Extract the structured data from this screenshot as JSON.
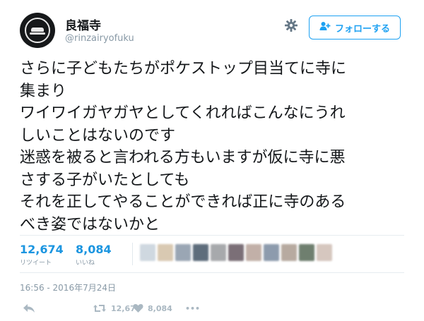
{
  "account": {
    "name": "良福寺",
    "handle": "@rinzairyofuku"
  },
  "follow_button": {
    "label": "フォローする",
    "icon": "add-user-icon"
  },
  "tweet": {
    "text": "さらに子どもたちがポケストップ目当てに寺に\n集まり\nワイワイガヤガヤとしてくれればこんなにうれ\nしいことはないのです\n迷惑を被ると言われる方もいますが仮に寺に悪\nさする子がいたとしても\nそれを正してやることができれば正に寺のある\nべき姿ではないかと",
    "timestamp": "16:56 - 2016年7月24日"
  },
  "stats": {
    "retweets": {
      "count": "12,674",
      "label": "リツイート"
    },
    "likes": {
      "count": "8,084",
      "label": "いいね"
    }
  },
  "actions": {
    "retweet_count": "12,674",
    "like_count": "8,084",
    "more_label": "•••"
  },
  "colors": {
    "accent": "#1da1f2",
    "stat_number": "#1b95e0",
    "muted": "#8899a6",
    "action_icon": "#aab8c2",
    "text": "#14171a"
  },
  "likers_blurred": [
    "#cfd8e0",
    "#d9c9b2",
    "#9aa6b4",
    "#5e6d7c",
    "#a7a9ac",
    "#7b6f77",
    "#c2b0a8",
    "#8d9bad",
    "#b7aaa0",
    "#6f7f6f",
    "#d6c7bf"
  ]
}
